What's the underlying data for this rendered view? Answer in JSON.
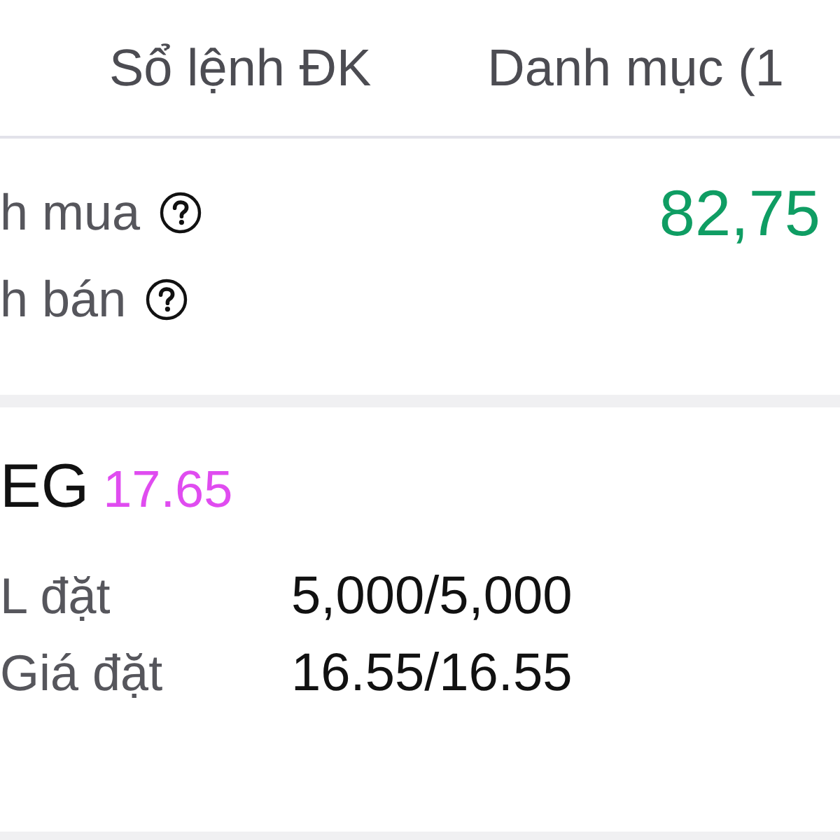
{
  "tabs": [
    {
      "label": "Sổ lệnh ĐK",
      "selected": false
    },
    {
      "label": "Danh mục (1",
      "selected": false
    }
  ],
  "summary": {
    "rows": [
      {
        "label": "h mua",
        "value": "82,75"
      },
      {
        "label": "h bán"
      }
    ]
  },
  "order": {
    "symbol": "EG",
    "price": "17.65",
    "fields": [
      {
        "label": "L đặt",
        "value": "5,000/5,000"
      },
      {
        "label": "Giá đặt",
        "value": "16.55/16.55"
      }
    ]
  }
}
